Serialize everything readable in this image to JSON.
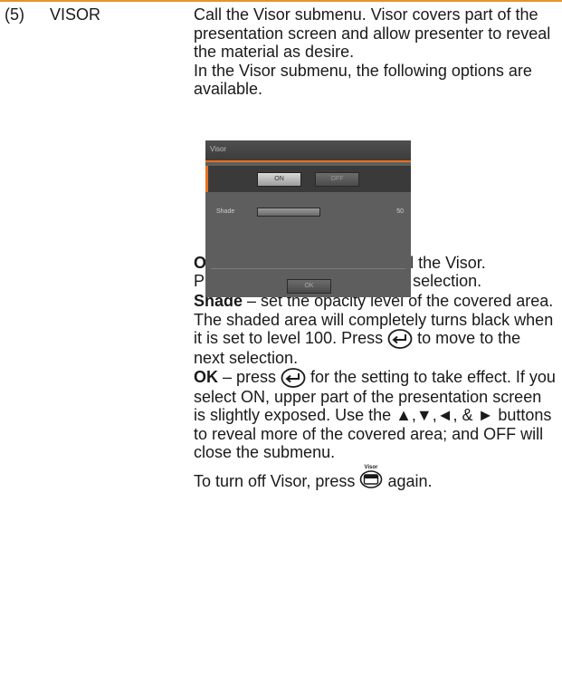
{
  "item": {
    "number": "(5)",
    "title": "VISOR"
  },
  "intro": {
    "line1": "Call the Visor submenu. Visor  covers part of the presentation screen and allow presenter to reveal the material as desire.",
    "line2": "In the Visor submenu, the following options are available."
  },
  "screenshot": {
    "title": "Visor",
    "on_label": "ON",
    "off_label": "OFF",
    "shade_label": "Shade",
    "shade_value": "50",
    "ok_label": "OK",
    "colors": {
      "accent": "#e8701f",
      "panel": "#5e5e5e",
      "selected_row": "#3a3a3a"
    }
  },
  "onoff": {
    "term": "ON/OFF",
    "text": " – select to run/cancel the Visor.",
    "press_before": "Press ",
    "press_after": " to move to the next selection."
  },
  "shade": {
    "term": "Shade",
    "text": " – set the opacity level of the covered area. The shaded area will completely turns black when it is set to level 100. Press ",
    "after": " to move to the next selection."
  },
  "ok": {
    "term": "OK",
    "text_before": " – press ",
    "text_after": " for the setting to take effect.  If you select ON, upper part of the presentation screen is slightly exposed. Use the ▲,▼,◄, & ► buttons to reveal more of the covered area; and OFF will close the submenu."
  },
  "turnoff": {
    "before": "To turn off Visor, press ",
    "after": " again."
  },
  "icons": {
    "enter": "enter-icon",
    "visor_button": "visor-button-icon",
    "visor_button_label": "Visor"
  },
  "colors": {
    "top_rule": "#e8922e",
    "text": "#1a1a1a"
  }
}
